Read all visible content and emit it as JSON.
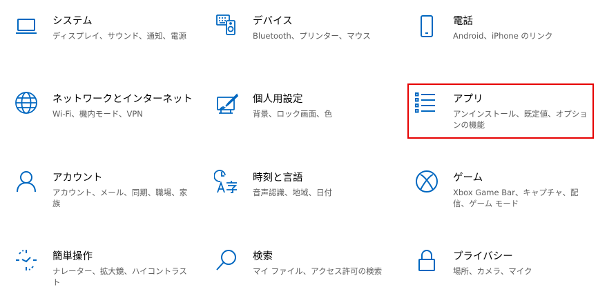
{
  "colors": {
    "accent": "#0067c0",
    "title": "#000000",
    "description": "#5d5d5d",
    "highlight": "#e60000"
  },
  "tiles": [
    {
      "key": "system",
      "icon": "monitor-icon",
      "title": "システム",
      "description": "ディスプレイ、サウンド、通知、電源"
    },
    {
      "key": "devices",
      "icon": "keyboard-speaker-icon",
      "title": "デバイス",
      "description": "Bluetooth、プリンター、マウス"
    },
    {
      "key": "phone",
      "icon": "phone-icon",
      "title": "電話",
      "description": "Android、iPhone のリンク"
    },
    {
      "key": "network",
      "icon": "globe-icon",
      "title": "ネットワークとインターネット",
      "description": "Wi-Fi、機内モード、VPN"
    },
    {
      "key": "personalization",
      "icon": "paint-screen-icon",
      "title": "個人用設定",
      "description": "背景、ロック画面、色"
    },
    {
      "key": "apps",
      "icon": "apps-list-icon",
      "title": "アプリ",
      "description": "アンインストール、既定値、オプションの機能",
      "highlighted": true
    },
    {
      "key": "accounts",
      "icon": "person-icon",
      "title": "アカウント",
      "description": "アカウント、メール、同期、職場、家族"
    },
    {
      "key": "time-language",
      "icon": "time-language-icon",
      "title": "時刻と言語",
      "description": "音声認識、地域、日付"
    },
    {
      "key": "gaming",
      "icon": "xbox-icon",
      "title": "ゲーム",
      "description": "Xbox Game Bar、キャプチャ、配信、ゲーム モード"
    },
    {
      "key": "ease-of-access",
      "icon": "ease-of-access-icon",
      "title": "簡単操作",
      "description": "ナレーター、拡大鏡、ハイコントラスト"
    },
    {
      "key": "search",
      "icon": "search-icon",
      "title": "検索",
      "description": "マイ ファイル、アクセス許可の検索"
    },
    {
      "key": "privacy",
      "icon": "lock-icon",
      "title": "プライバシー",
      "description": "場所、カメラ、マイク"
    }
  ]
}
